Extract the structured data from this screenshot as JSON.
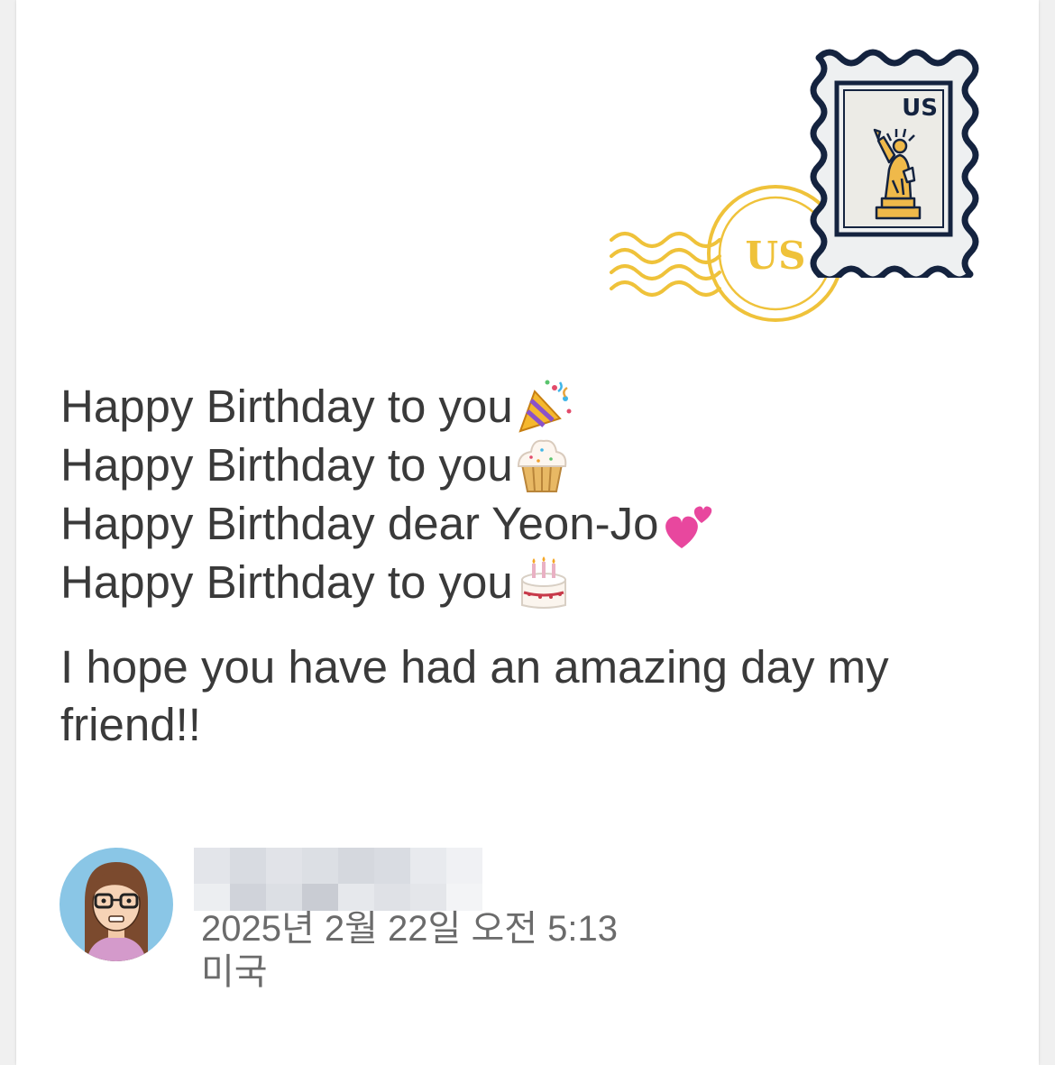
{
  "stamp": {
    "country": "US",
    "icon": "statue-of-liberty-icon",
    "border_color": "#14233f",
    "fill_color": "#eef0f1",
    "figure_color": "#efb94a"
  },
  "postmark": {
    "text": "US",
    "color": "#efc23a"
  },
  "message": {
    "lines": [
      {
        "text": "Happy Birthday to you",
        "emoji": "party-popper-icon"
      },
      {
        "text": "Happy Birthday to you",
        "emoji": "cupcake-icon"
      },
      {
        "text": "Happy Birthday dear Yeon-Jo",
        "emoji": "two-hearts-icon"
      },
      {
        "text": "Happy Birthday to you",
        "emoji": "birthday-cake-icon"
      }
    ],
    "wish": "I hope you have had an amazing day my friend!!"
  },
  "author": {
    "avatar": "woman-with-glasses-avatar",
    "name_redacted": true,
    "timestamp": "2025년 2월 22일 오전 5:13",
    "location": "미국"
  }
}
